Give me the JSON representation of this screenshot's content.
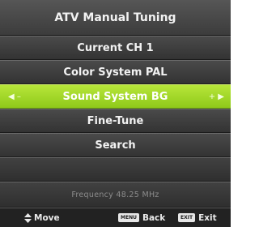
{
  "title": "ATV Manual Tuning",
  "items": [
    {
      "label": "Current CH 1"
    },
    {
      "label": "Color System PAL"
    },
    {
      "label": "Sound System BG",
      "selected": true
    },
    {
      "label": "Fine-Tune"
    },
    {
      "label": "Search"
    }
  ],
  "frequency": "Frequency  48.25 MHz",
  "footer": {
    "move_label": "Move",
    "menu_key": "MENU",
    "back_label": "Back",
    "exit_key": "EXIT",
    "exit_label": "Exit"
  },
  "colors": {
    "highlight": "#a6d92c",
    "background": "#2f2f2f"
  }
}
